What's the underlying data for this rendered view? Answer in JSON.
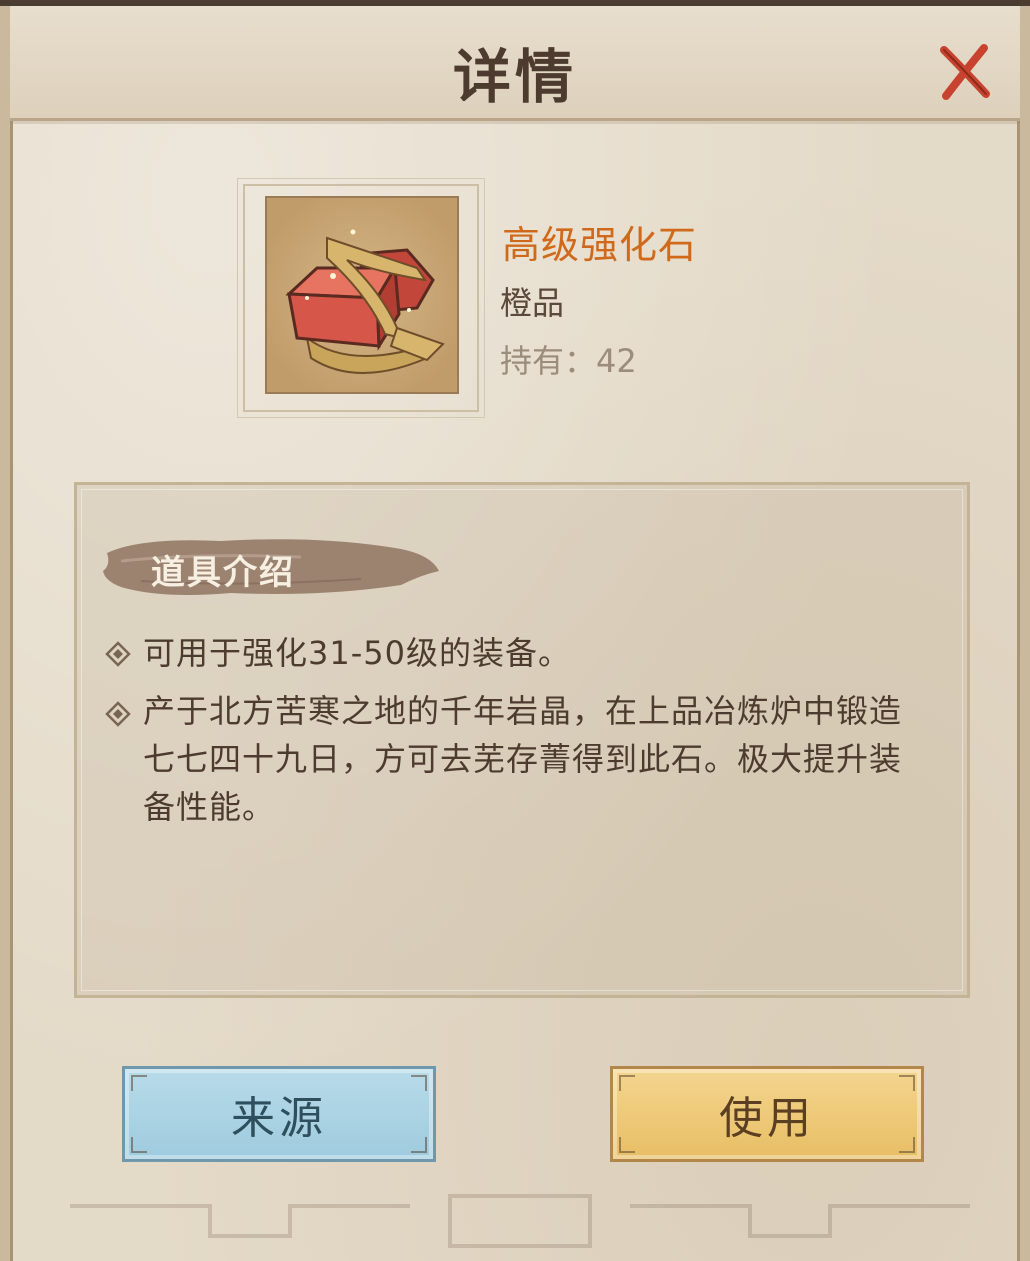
{
  "dialog": {
    "title": "详情"
  },
  "item": {
    "name": "高级强化石",
    "quality": "橙品",
    "owned_label": "持有：",
    "owned_count": "42",
    "name_color": "#d06a1a"
  },
  "description": {
    "section_label": "道具介绍",
    "lines": [
      "可用于强化31-50级的装备。",
      "产于北方苦寒之地的千年岩晶，在上品冶炼炉中锻造七七四十九日，方可去芜存菁得到此石。极大提升装备性能。"
    ]
  },
  "buttons": {
    "source_label": "来源",
    "use_label": "使用"
  },
  "icons": {
    "close": "close-icon",
    "bullet": "diamond-bullet-icon",
    "item": "enhancement-stone-icon"
  }
}
